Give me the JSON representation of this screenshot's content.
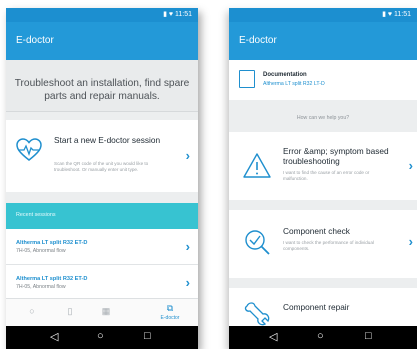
{
  "phone1": {
    "app_title": "E-doctor",
    "header_text": "Troubleshoot an installation, find spare parts and repair manuals.",
    "new_session": {
      "title": "Start a new E-doctor session",
      "subtitle": "Scan the QR code of the unit you would like to troubleshoot. Or manually enter unit type."
    },
    "recent_label": "Recent sessions",
    "sessions": [
      {
        "name": "Altherma LT split R32 ET-D",
        "detail": "7H-05, Abnormal flow"
      },
      {
        "name": "Altherma LT split R32 ET-D",
        "detail": "7H-05, Abnormal flow"
      }
    ],
    "tabs": [
      {
        "icon": "home-icon",
        "label": ""
      },
      {
        "icon": "book-icon",
        "label": ""
      },
      {
        "icon": "grid-icon",
        "label": ""
      },
      {
        "icon": "doctor-icon",
        "label": "E-doctor"
      }
    ]
  },
  "phone2": {
    "app_title": "E-doctor",
    "documentation": {
      "title": "Documentation",
      "subtitle": "Altherma LT split R32 LT-D"
    },
    "help_text": "How can we help you?",
    "options": [
      {
        "title": "Error &amp; symptom based troubleshooting",
        "subtitle": "I want to find the cause of an error code or malfunction.",
        "icon": "warning-icon"
      },
      {
        "title": "Component check",
        "subtitle": "I want to check the performance of individual components.",
        "icon": "check-search-icon"
      },
      {
        "title": "Component repair",
        "subtitle": "",
        "icon": "wrench-icon"
      }
    ]
  },
  "system": {
    "time": "11:51",
    "nav": [
      "◁",
      "○",
      "□"
    ]
  },
  "colors": {
    "primary": "#2399d8",
    "accent_cyan": "#37c3d1",
    "link": "#1d8fcf"
  }
}
